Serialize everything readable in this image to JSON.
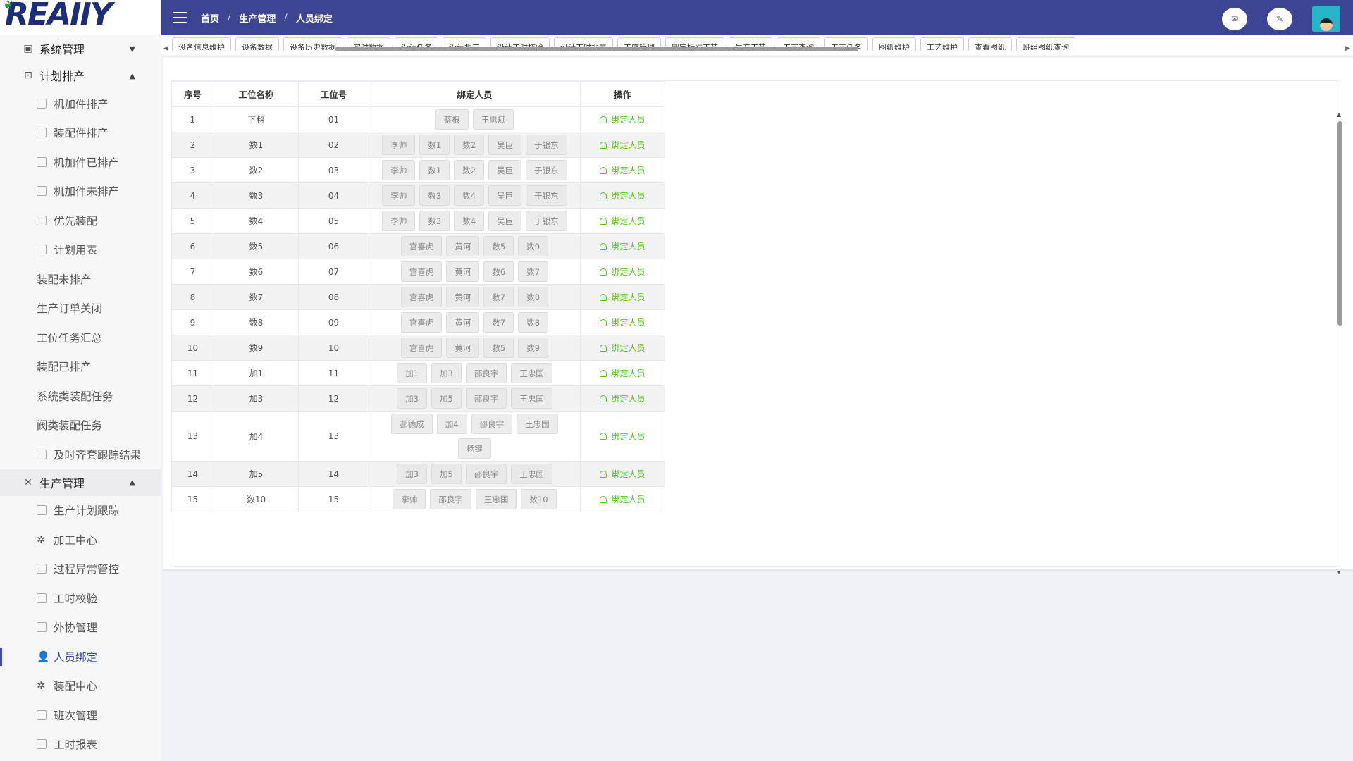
{
  "logo": {
    "text": "REAIIY"
  },
  "sidebar": {
    "groups": [
      {
        "label": "系统管理",
        "icon": "monitor-icon",
        "expanded": false,
        "items": []
      },
      {
        "label": "计划排产",
        "icon": "calendar-icon",
        "expanded": true,
        "items": [
          "机加件排产",
          "装配件排产",
          "机加件已排产",
          "机加件未排产",
          "优先装配",
          "计划用表",
          "装配未排产",
          "生产订单关闭",
          "工位任务汇总",
          "装配已排产",
          "系统类装配任务",
          "阀类装配任务",
          "及时齐套跟踪结果"
        ]
      },
      {
        "label": "生产管理",
        "icon": "tools-icon",
        "expanded": true,
        "items": [
          "生产计划跟踪",
          "加工中心",
          "过程异常管控",
          "工时校验",
          "外协管理",
          "人员绑定",
          "装配中心",
          "班次管理",
          "工时报表"
        ]
      }
    ],
    "active_item": "人员绑定"
  },
  "header": {
    "breadcrumb": [
      "首页",
      "生产管理",
      "人员绑定"
    ],
    "separator": "/"
  },
  "tabs": [
    "设备信息维护",
    "设备数据",
    "设备历史数据",
    "实时数据",
    "设计任务",
    "设计报工",
    "设计工时核验",
    "设计工时报表",
    "工序管理",
    "制定标准工艺",
    "生产工艺",
    "工艺查询",
    "工艺任务",
    "图纸维护",
    "工艺维护",
    "查看图纸",
    "班组图纸查询"
  ],
  "table": {
    "headers": [
      "序号",
      "工位名称",
      "工位号",
      "绑定人员",
      "操作"
    ],
    "action_label": "绑定人员",
    "rows": [
      {
        "seq": "1",
        "name": "下料",
        "no": "01",
        "people": [
          "蔡根",
          "王忠斌"
        ]
      },
      {
        "seq": "2",
        "name": "数1",
        "no": "02",
        "people": [
          "李帅",
          "数1",
          "数2",
          "吴臣",
          "于银东"
        ]
      },
      {
        "seq": "3",
        "name": "数2",
        "no": "03",
        "people": [
          "李帅",
          "数1",
          "数2",
          "吴臣",
          "于银东"
        ]
      },
      {
        "seq": "4",
        "name": "数3",
        "no": "04",
        "people": [
          "李帅",
          "数3",
          "数4",
          "吴臣",
          "于银东"
        ]
      },
      {
        "seq": "5",
        "name": "数4",
        "no": "05",
        "people": [
          "李帅",
          "数3",
          "数4",
          "吴臣",
          "于银东"
        ]
      },
      {
        "seq": "6",
        "name": "数5",
        "no": "06",
        "people": [
          "宫喜虎",
          "黄河",
          "数5",
          "数9"
        ]
      },
      {
        "seq": "7",
        "name": "数6",
        "no": "07",
        "people": [
          "宫喜虎",
          "黄河",
          "数6",
          "数7"
        ]
      },
      {
        "seq": "8",
        "name": "数7",
        "no": "08",
        "people": [
          "宫喜虎",
          "黄河",
          "数7",
          "数8"
        ]
      },
      {
        "seq": "9",
        "name": "数8",
        "no": "09",
        "people": [
          "宫喜虎",
          "黄河",
          "数7",
          "数8"
        ]
      },
      {
        "seq": "10",
        "name": "数9",
        "no": "10",
        "people": [
          "宫喜虎",
          "黄河",
          "数5",
          "数9"
        ]
      },
      {
        "seq": "11",
        "name": "加1",
        "no": "11",
        "people": [
          "加1",
          "加3",
          "邵良宇",
          "王忠国"
        ]
      },
      {
        "seq": "12",
        "name": "加3",
        "no": "12",
        "people": [
          "加3",
          "加5",
          "邵良宇",
          "王忠国"
        ]
      },
      {
        "seq": "13",
        "name": "加4",
        "no": "13",
        "people": [
          "郝德成",
          "加4",
          "邵良宇",
          "王忠国",
          "杨键"
        ]
      },
      {
        "seq": "14",
        "name": "加5",
        "no": "14",
        "people": [
          "加3",
          "加5",
          "邵良宇",
          "王忠国"
        ]
      },
      {
        "seq": "15",
        "name": "数10",
        "no": "15",
        "people": [
          "李帅",
          "邵良宇",
          "王忠国",
          "数10"
        ]
      }
    ]
  },
  "colors": {
    "header_bg": "#3b4592",
    "accent_green": "#52c41a",
    "active_menu": "#3b4ba0"
  }
}
